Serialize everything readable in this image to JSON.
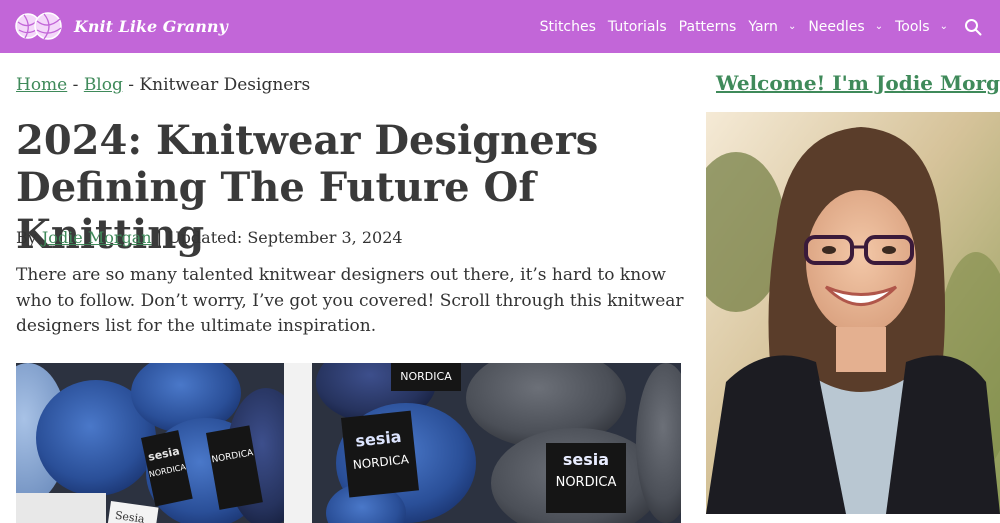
{
  "header": {
    "brand": "Knit Like Granny",
    "nav": [
      {
        "label": "Stitches",
        "dropdown": false
      },
      {
        "label": "Tutorials",
        "dropdown": false
      },
      {
        "label": "Patterns",
        "dropdown": false
      },
      {
        "label": "Yarn",
        "dropdown": true
      },
      {
        "label": "Needles",
        "dropdown": true
      },
      {
        "label": "Tools",
        "dropdown": true
      }
    ],
    "icons": {
      "logo": "yarn-balls-icon",
      "search": "search-icon",
      "dropdown": "chevron-down-icon"
    }
  },
  "colors": {
    "header_bg": "#c266d8",
    "link": "#3f8a5a",
    "text": "#333333"
  },
  "breadcrumb": {
    "home": "Home",
    "sep": "-",
    "blog": "Blog",
    "current": "Knitwear Designers"
  },
  "article": {
    "title": "2024: Knitwear Designers Defining The Future Of Knitting",
    "byline_prefix": "By",
    "author": "Jodie Morgan",
    "byline_sep": "|",
    "updated": "Updated: September 3, 2024",
    "intro": "There are so many talented knitwear designers out there, it’s hard to know who to follow. Don’t worry, I’ve got you covered! Scroll through this knitwear designers list for the ultimate inspiration.",
    "hero_labels": [
      "sesia",
      "NORDICA",
      "NORDICA",
      "sesia",
      "NORDICA",
      "sesia",
      "NORDICA",
      "NORDICA",
      "Sesia"
    ]
  },
  "sidebar": {
    "welcome": "Welcome! I'm Jodie Morgan"
  }
}
